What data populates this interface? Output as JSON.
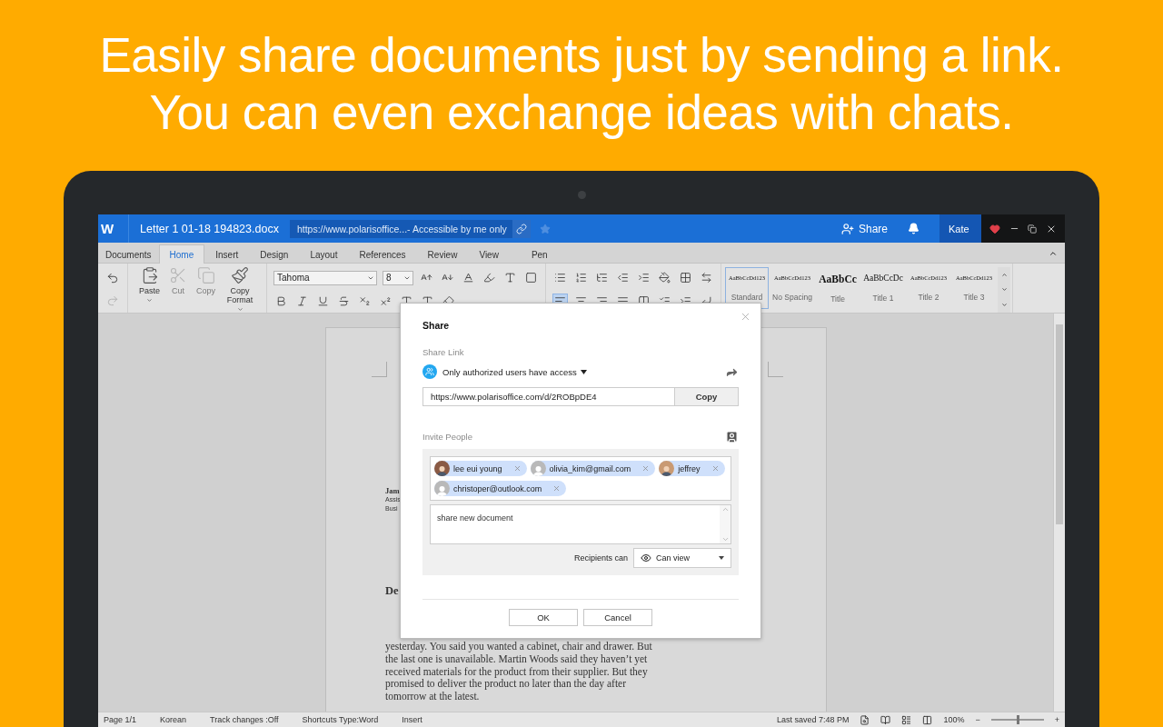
{
  "headline": [
    "Easily share documents just by sending a link.",
    "You can even exchange ideas with chats."
  ],
  "titlebar": {
    "logo": "W",
    "filename": "Letter 1 01-18 194823.docx",
    "link": "https://www.polarisoffice...- Accessible by me only",
    "share": "Share",
    "user": "Kate"
  },
  "tabs": [
    {
      "label": "Documents",
      "selected": false
    },
    {
      "label": "Home",
      "selected": true
    },
    {
      "label": "Insert",
      "selected": false
    },
    {
      "label": "Design",
      "selected": false
    },
    {
      "label": "Layout",
      "selected": false
    },
    {
      "label": "References",
      "selected": false
    },
    {
      "label": "Review",
      "selected": false
    },
    {
      "label": "View",
      "selected": false
    },
    {
      "label": "Pen",
      "selected": false
    }
  ],
  "ribbon": {
    "clipboard": [
      {
        "kind": "paste",
        "label": "Paste",
        "disabled": false,
        "dropdown": true
      },
      {
        "kind": "cut",
        "label": "Cut",
        "disabled": true,
        "dropdown": false
      },
      {
        "kind": "copy",
        "label": "Copy",
        "disabled": true,
        "dropdown": false
      },
      {
        "kind": "format",
        "label": "Copy Format",
        "disabled": false,
        "dropdown": true
      }
    ],
    "font": "Tahoma",
    "size": "8",
    "align": [
      {
        "kind": "left",
        "selected": true
      },
      {
        "kind": "center",
        "selected": false
      },
      {
        "kind": "right",
        "selected": false
      },
      {
        "kind": "justify",
        "selected": false
      }
    ],
    "styles": [
      {
        "kind": "body",
        "preview": "AaBbCcDd123",
        "label": "Standard",
        "selected": true
      },
      {
        "kind": "body",
        "preview": "AaBbCcDd123",
        "label": "No Spacing",
        "selected": false
      },
      {
        "kind": "title",
        "preview": "AaBbCc",
        "label": "Title",
        "selected": false
      },
      {
        "kind": "heading",
        "preview": "AaBbCcDc",
        "label": "Title 1",
        "selected": false
      },
      {
        "kind": "body",
        "preview": "AaBbCcDd123",
        "label": "Title 2",
        "selected": false
      },
      {
        "kind": "body",
        "preview": "AaBbCcDd123",
        "label": "Title 3",
        "selected": false
      }
    ]
  },
  "document": {
    "sender": [
      "Jam",
      "Assis",
      "Busi"
    ],
    "salutation": "De",
    "body": [
      "yesterday. You said you wanted a cabinet, chair and drawer. But",
      "the last one is unavailable. Martin Woods said they haven’t yet",
      "received materials for the product from their supplier. But they",
      "promised to deliver the product no later than the day after",
      "tomorrow at the latest."
    ]
  },
  "dialog": {
    "title": "Share",
    "share_link_label": "Share Link",
    "access": "Only authorized users have access",
    "url": "https://www.polarisoffice.com/d/2ROBpDE4",
    "copy": "Copy",
    "invite_label": "Invite People",
    "invitees": [
      {
        "kind": "photo",
        "name": "lee eui young",
        "color": "#8a5a44"
      },
      {
        "kind": "generic",
        "name": "olivia_kim@gmail.com",
        "color": "#b9b9b9"
      },
      {
        "kind": "photo",
        "name": "jeffrey",
        "color": "#c99a73"
      },
      {
        "kind": "generic",
        "name": "christoper@outlook.com",
        "color": "#b9b9b9"
      }
    ],
    "message": "share new document",
    "recipients_label": "Recipients can",
    "permission": "Can view",
    "ok": "OK",
    "cancel": "Cancel"
  },
  "status_bar": {
    "items": [
      "Page 1/1",
      "Korean",
      "Track changes :Off",
      "Shortcuts Type:Word",
      "Insert"
    ],
    "last_saved": "Last saved 7:48 PM",
    "zoom": "100%",
    "zoom_out": "−",
    "zoom_in": "+",
    "zoom_slider": {
      "level": 0.5
    }
  }
}
